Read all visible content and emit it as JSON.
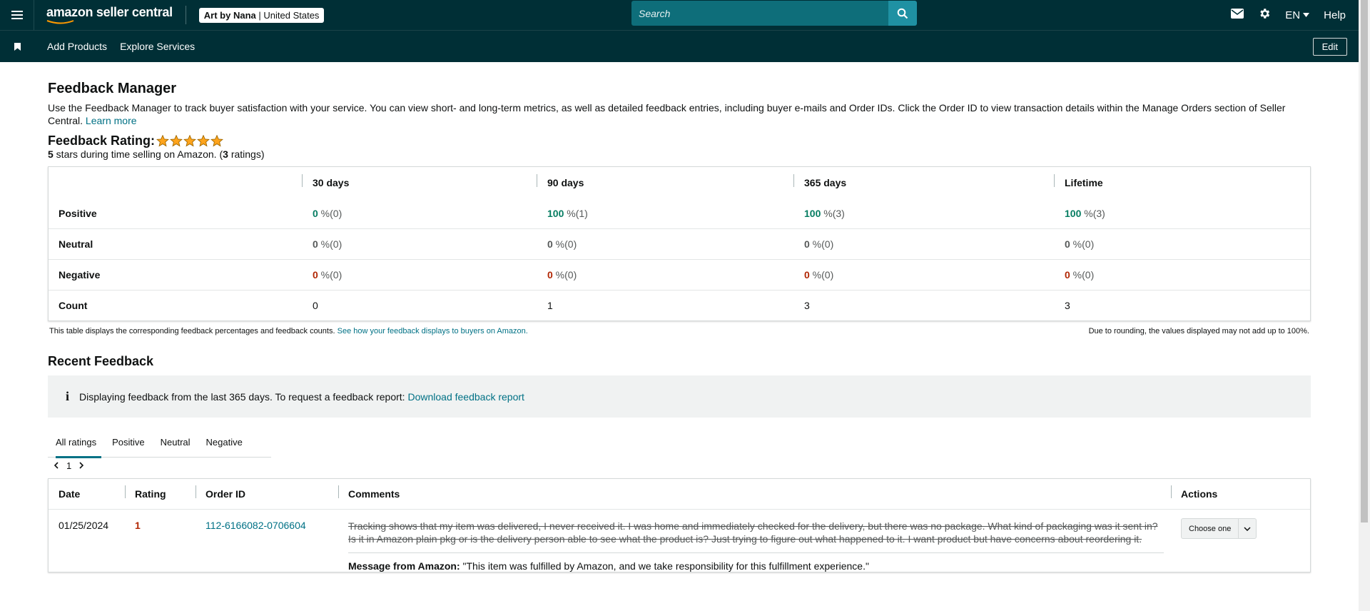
{
  "header": {
    "logo_text": "amazon seller central",
    "store_name": "Art by Nana",
    "store_region": "United States",
    "search_placeholder": "Search",
    "lang": "EN",
    "help": "Help"
  },
  "nav": {
    "items": [
      "Add Products",
      "Explore Services"
    ],
    "edit": "Edit"
  },
  "page": {
    "title": "Feedback Manager",
    "intro": "Use the Feedback Manager to track buyer satisfaction with your service. You can view short- and long-term metrics, as well as detailed feedback entries, including buyer e-mails and Order IDs. Click the Order ID to view transaction details within the Manage Orders section of Seller Central.",
    "learn_more": "Learn more",
    "rating_title": "Feedback Rating:",
    "stars_count": 5,
    "star_color": "#ffa41c",
    "rating_stars": "5",
    "rating_sub_mid": " stars during time selling on Amazon. (",
    "rating_count": "3",
    "rating_sub_end": " ratings)"
  },
  "metrics": {
    "headers": [
      "30 days",
      "90 days",
      "365 days",
      "Lifetime"
    ],
    "rows": [
      {
        "label": "Positive",
        "values": [
          "0",
          "100",
          "100",
          "100"
        ],
        "counts": [
          "(0)",
          "(1)",
          "(3)",
          "(3)"
        ]
      },
      {
        "label": "Neutral",
        "values": [
          "0",
          "0",
          "0",
          "0"
        ],
        "counts": [
          "(0)",
          "(0)",
          "(0)",
          "(0)"
        ]
      },
      {
        "label": "Negative",
        "values": [
          "0",
          "0",
          "0",
          "0"
        ],
        "counts": [
          "(0)",
          "(0)",
          "(0)",
          "(0)"
        ]
      },
      {
        "label": "Count",
        "values": [
          "0",
          "1",
          "3",
          "3"
        ]
      }
    ],
    "pct_sign": " %",
    "note_left": "This table displays the corresponding feedback percentages and feedback counts.",
    "note_link": "See how your feedback displays to buyers on Amazon.",
    "note_right": "Due to rounding, the values displayed may not add up to 100%."
  },
  "recent": {
    "title": "Recent Feedback",
    "info_text": "Displaying feedback from the last 365 days. To request a feedback report:",
    "info_link": "Download feedback report",
    "tabs": [
      "All ratings",
      "Positive",
      "Neutral",
      "Negative"
    ],
    "page": "1",
    "columns": [
      "Date",
      "Rating",
      "Order ID",
      "Comments",
      "Actions"
    ],
    "rows": [
      {
        "date": "01/25/2024",
        "rating": "1",
        "order_id": "112-6166082-0706604",
        "comment": "Tracking shows that my item was delivered, I never received it. I was home and immediately checked for the delivery, but there was no package. What kind of packaging was it sent in? Is it in Amazon plain pkg or is the delivery person able to see what the product is? Just trying to figure out what happened to it. I want product but have concerns about reordering it.",
        "amazon_msg_label": "Message from Amazon:",
        "amazon_msg": " \"This item was fulfilled by Amazon, and we take responsibility for this fulfillment experience.\"",
        "action": "Choose one"
      }
    ]
  }
}
